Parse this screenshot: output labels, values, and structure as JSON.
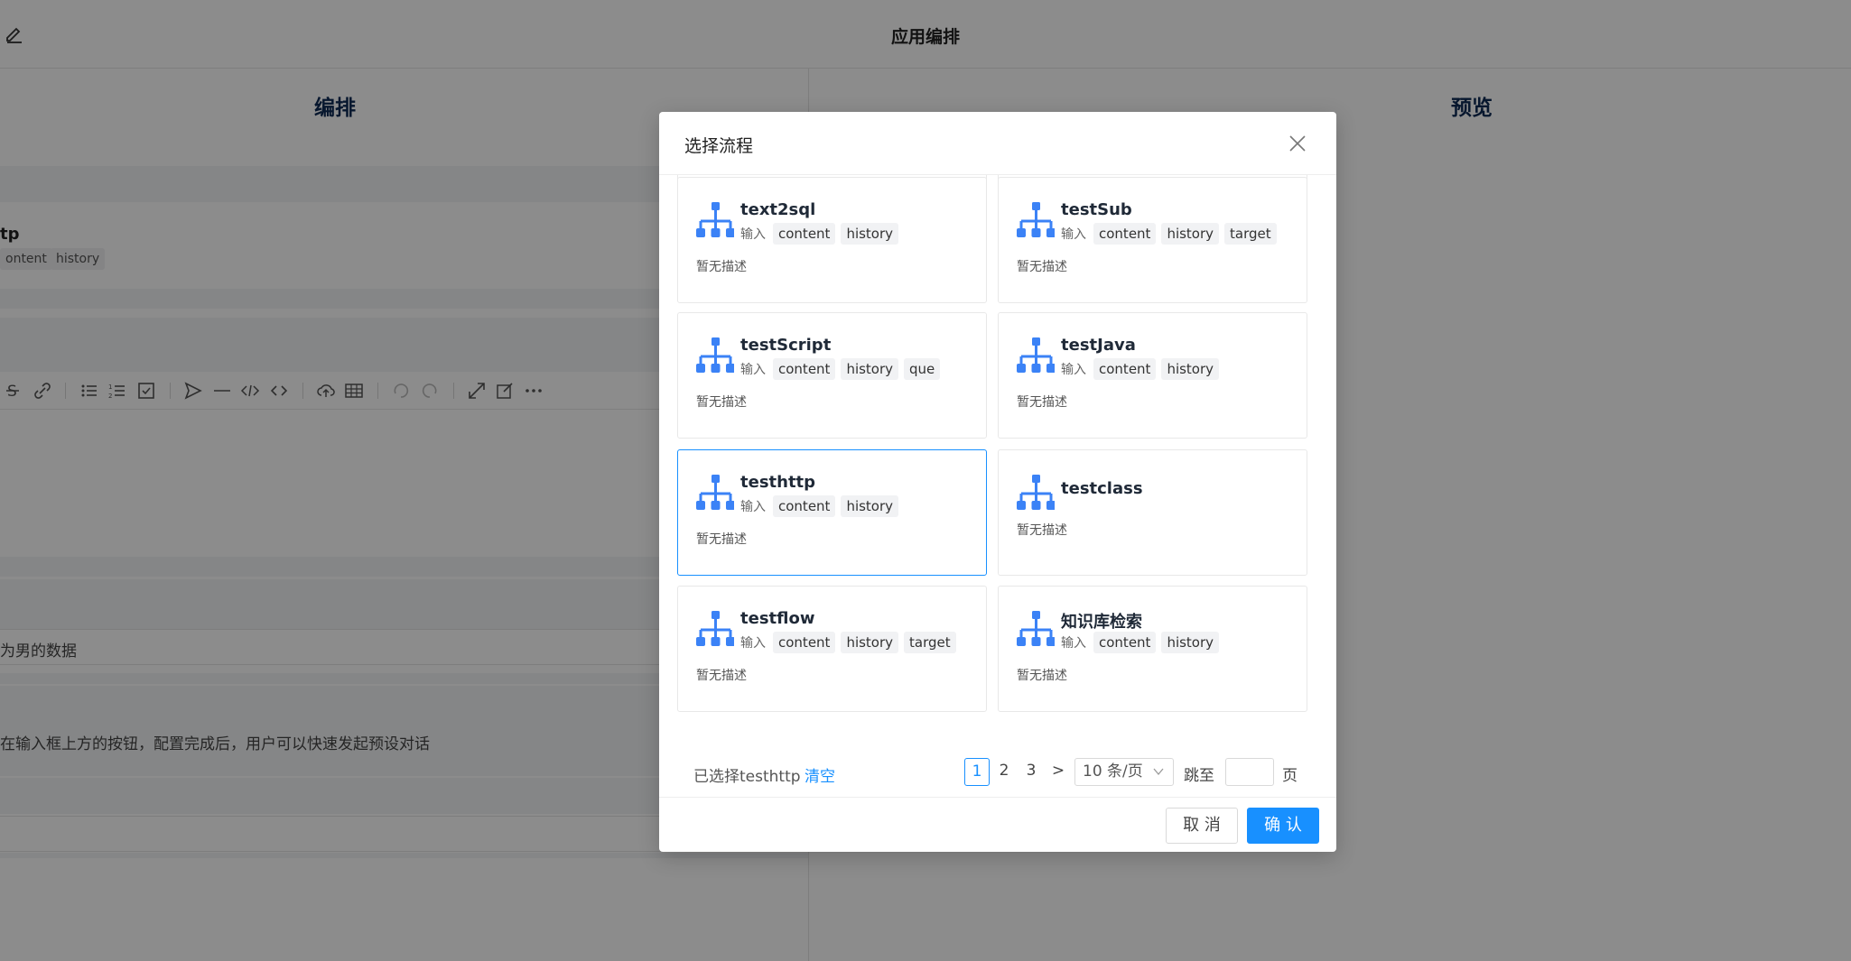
{
  "app": {
    "title": "应用编排",
    "left_panel_title": "编排",
    "right_panel_title": "预览",
    "bg_flow_name": "tp",
    "bg_flow_tags": [
      "ontent",
      "history"
    ],
    "bg_text_1": "为男的数据",
    "bg_text_2": "在输入框上方的按钮，配置完成后，用户可以快速发起预设对话"
  },
  "modal": {
    "title": "选择流程",
    "input_label": "输入",
    "default_desc": "暂无描述",
    "cards": [
      {
        "name": "text2sql",
        "tags": [
          "content",
          "history"
        ]
      },
      {
        "name": "testSub",
        "tags": [
          "content",
          "history",
          "target"
        ]
      },
      {
        "name": "testScript",
        "tags": [
          "content",
          "history",
          "que"
        ]
      },
      {
        "name": "testJava",
        "tags": [
          "content",
          "history"
        ]
      },
      {
        "name": "testhttp",
        "tags": [
          "content",
          "history"
        ]
      },
      {
        "name": "testclass",
        "tags": []
      },
      {
        "name": "testflow",
        "tags": [
          "content",
          "history",
          "target"
        ]
      },
      {
        "name": "知识库检索",
        "tags": [
          "content",
          "history"
        ]
      }
    ],
    "selected_text": "已选择testhttp",
    "clear_label": "清空",
    "pagination": {
      "pages": [
        "1",
        "2",
        "3"
      ],
      "current": "1",
      "next": ">",
      "page_size": "10 条/页",
      "jump_label": "跳至",
      "page_unit": "页"
    },
    "cancel_label": "取 消",
    "confirm_label": "确 认"
  },
  "colors": {
    "primary": "#1890ff",
    "icon_blue": "#3b82f6",
    "overlay": "rgba(0,0,0,0.45)"
  }
}
